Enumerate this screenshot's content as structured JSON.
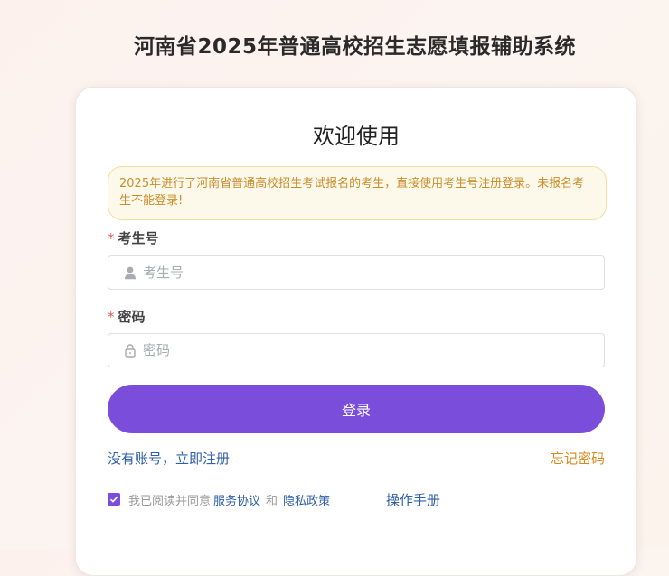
{
  "page": {
    "title": "河南省2025年普通高校招生志愿填报辅助系统"
  },
  "login": {
    "welcome": "欢迎使用",
    "notice": "2025年进行了河南省普通高校招生考试报名的考生，直接使用考生号注册登录。未报名考生不能登录!",
    "required_mark": "*",
    "exam_id_label": "考生号",
    "exam_id_placeholder": "考生号",
    "exam_id_value": "",
    "password_label": "密码",
    "password_placeholder": "密码",
    "password_value": "",
    "submit_label": "登录",
    "register_link": "没有账号，立即注册",
    "forgot_link": "忘记密码",
    "agree_text": "我已阅读并同意",
    "service_agreement": "服务协议",
    "and_text": "和",
    "privacy_policy": "隐私政策",
    "agree_checked": true,
    "manual_link": "操作手册"
  },
  "icons": {
    "exam_id": "user-icon",
    "password": "lock-icon",
    "checkbox": "check-icon"
  },
  "colors": {
    "primary": "#7a4edb",
    "link": "#2f5fa8",
    "warning": "#d98a1e",
    "notice_bg": "#fdf9ea",
    "notice_text": "#c98d2c",
    "required": "#e05a4f"
  }
}
